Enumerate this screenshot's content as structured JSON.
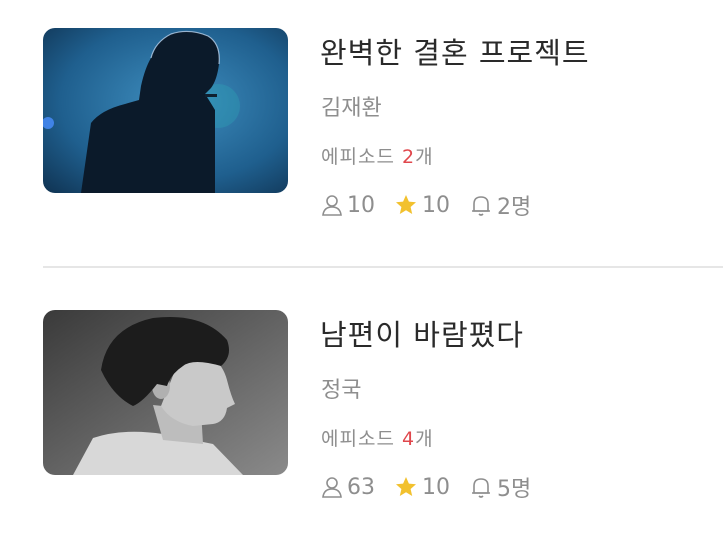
{
  "stories": [
    {
      "title": "완벽한 결혼 프로젝트",
      "author": "김재환",
      "episode_prefix": "에피소드 ",
      "episode_count": "2",
      "episode_suffix": "개",
      "readers": "10",
      "stars": "10",
      "subscribers": "2명"
    },
    {
      "title": "남편이 바람폈다",
      "author": "정국",
      "episode_prefix": "에피소드 ",
      "episode_count": "4",
      "episode_suffix": "개",
      "readers": "63",
      "stars": "10",
      "subscribers": "5명"
    }
  ],
  "colors": {
    "accent_count": "#e0474c",
    "star": "#f2c12e",
    "muted_text": "#8e8e8e",
    "title_text": "#2a2a2a"
  }
}
